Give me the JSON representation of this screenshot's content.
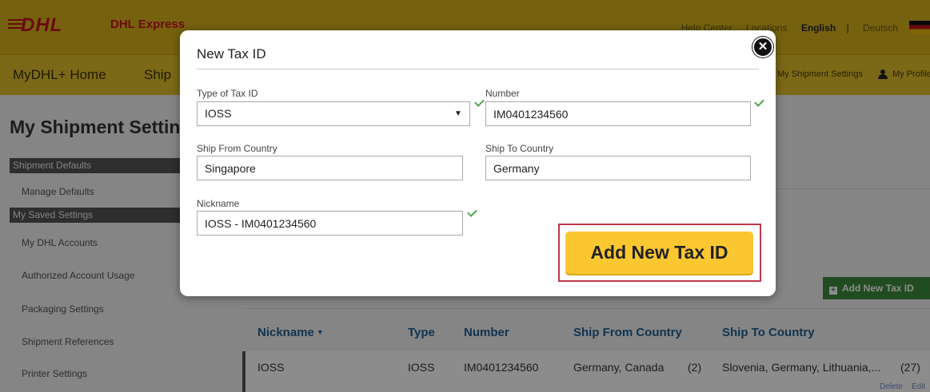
{
  "header": {
    "brand": "DHL",
    "brand_sub": "DHL Express",
    "help": "Help Center",
    "locations": "Locations",
    "lang_active": "English",
    "lang_sep": "|",
    "lang_other": "Deutsch"
  },
  "nav": {
    "home": "MyDHL+ Home",
    "ship": "Ship",
    "shipment_settings": "My Shipment Settings",
    "profile": "My Profile"
  },
  "sidebar": {
    "page_title": "My Shipment Settings",
    "sections": [
      {
        "label": "Shipment Defaults",
        "items": [
          "Manage Defaults"
        ]
      },
      {
        "label": "My Saved Settings",
        "items": [
          "My DHL Accounts",
          "Authorized Account Usage",
          "Packaging Settings",
          "Shipment References",
          "Printer Settings"
        ]
      }
    ]
  },
  "main": {
    "add_button": "Add New Tax ID",
    "table": {
      "columns": [
        "Nickname",
        "Type",
        "Number",
        "Ship From Country",
        "Ship To Country"
      ],
      "sort_indicator": "▼",
      "rows": [
        {
          "nickname": "IOSS",
          "type": "IOSS",
          "number": "IM0401234560",
          "from": "Germany, Canada",
          "from_count": "(2)",
          "to": "Slovenia, Germany, Lithuania,...",
          "to_count": "(27)"
        }
      ],
      "row_actions": [
        "Delete",
        "Edit"
      ]
    }
  },
  "modal": {
    "title": "New Tax ID",
    "close": "✕",
    "type_label": "Type of Tax ID",
    "type_value": "IOSS",
    "number_label": "Number",
    "number_value": "IM0401234560",
    "from_label": "Ship From Country",
    "from_value": "Singapore",
    "to_label": "Ship To Country",
    "to_value": "Germany",
    "nickname_label": "Nickname",
    "nickname_value": "IOSS - IM0401234560",
    "submit": "Add New Tax ID"
  },
  "colors": {
    "header_yellow": "#d8b21a",
    "primary_button": "#fbc731",
    "highlight": "#c0354a",
    "success_check": "#4fa64f",
    "table_header": "#1f5f93",
    "add_button_green": "#3d8b3d"
  }
}
